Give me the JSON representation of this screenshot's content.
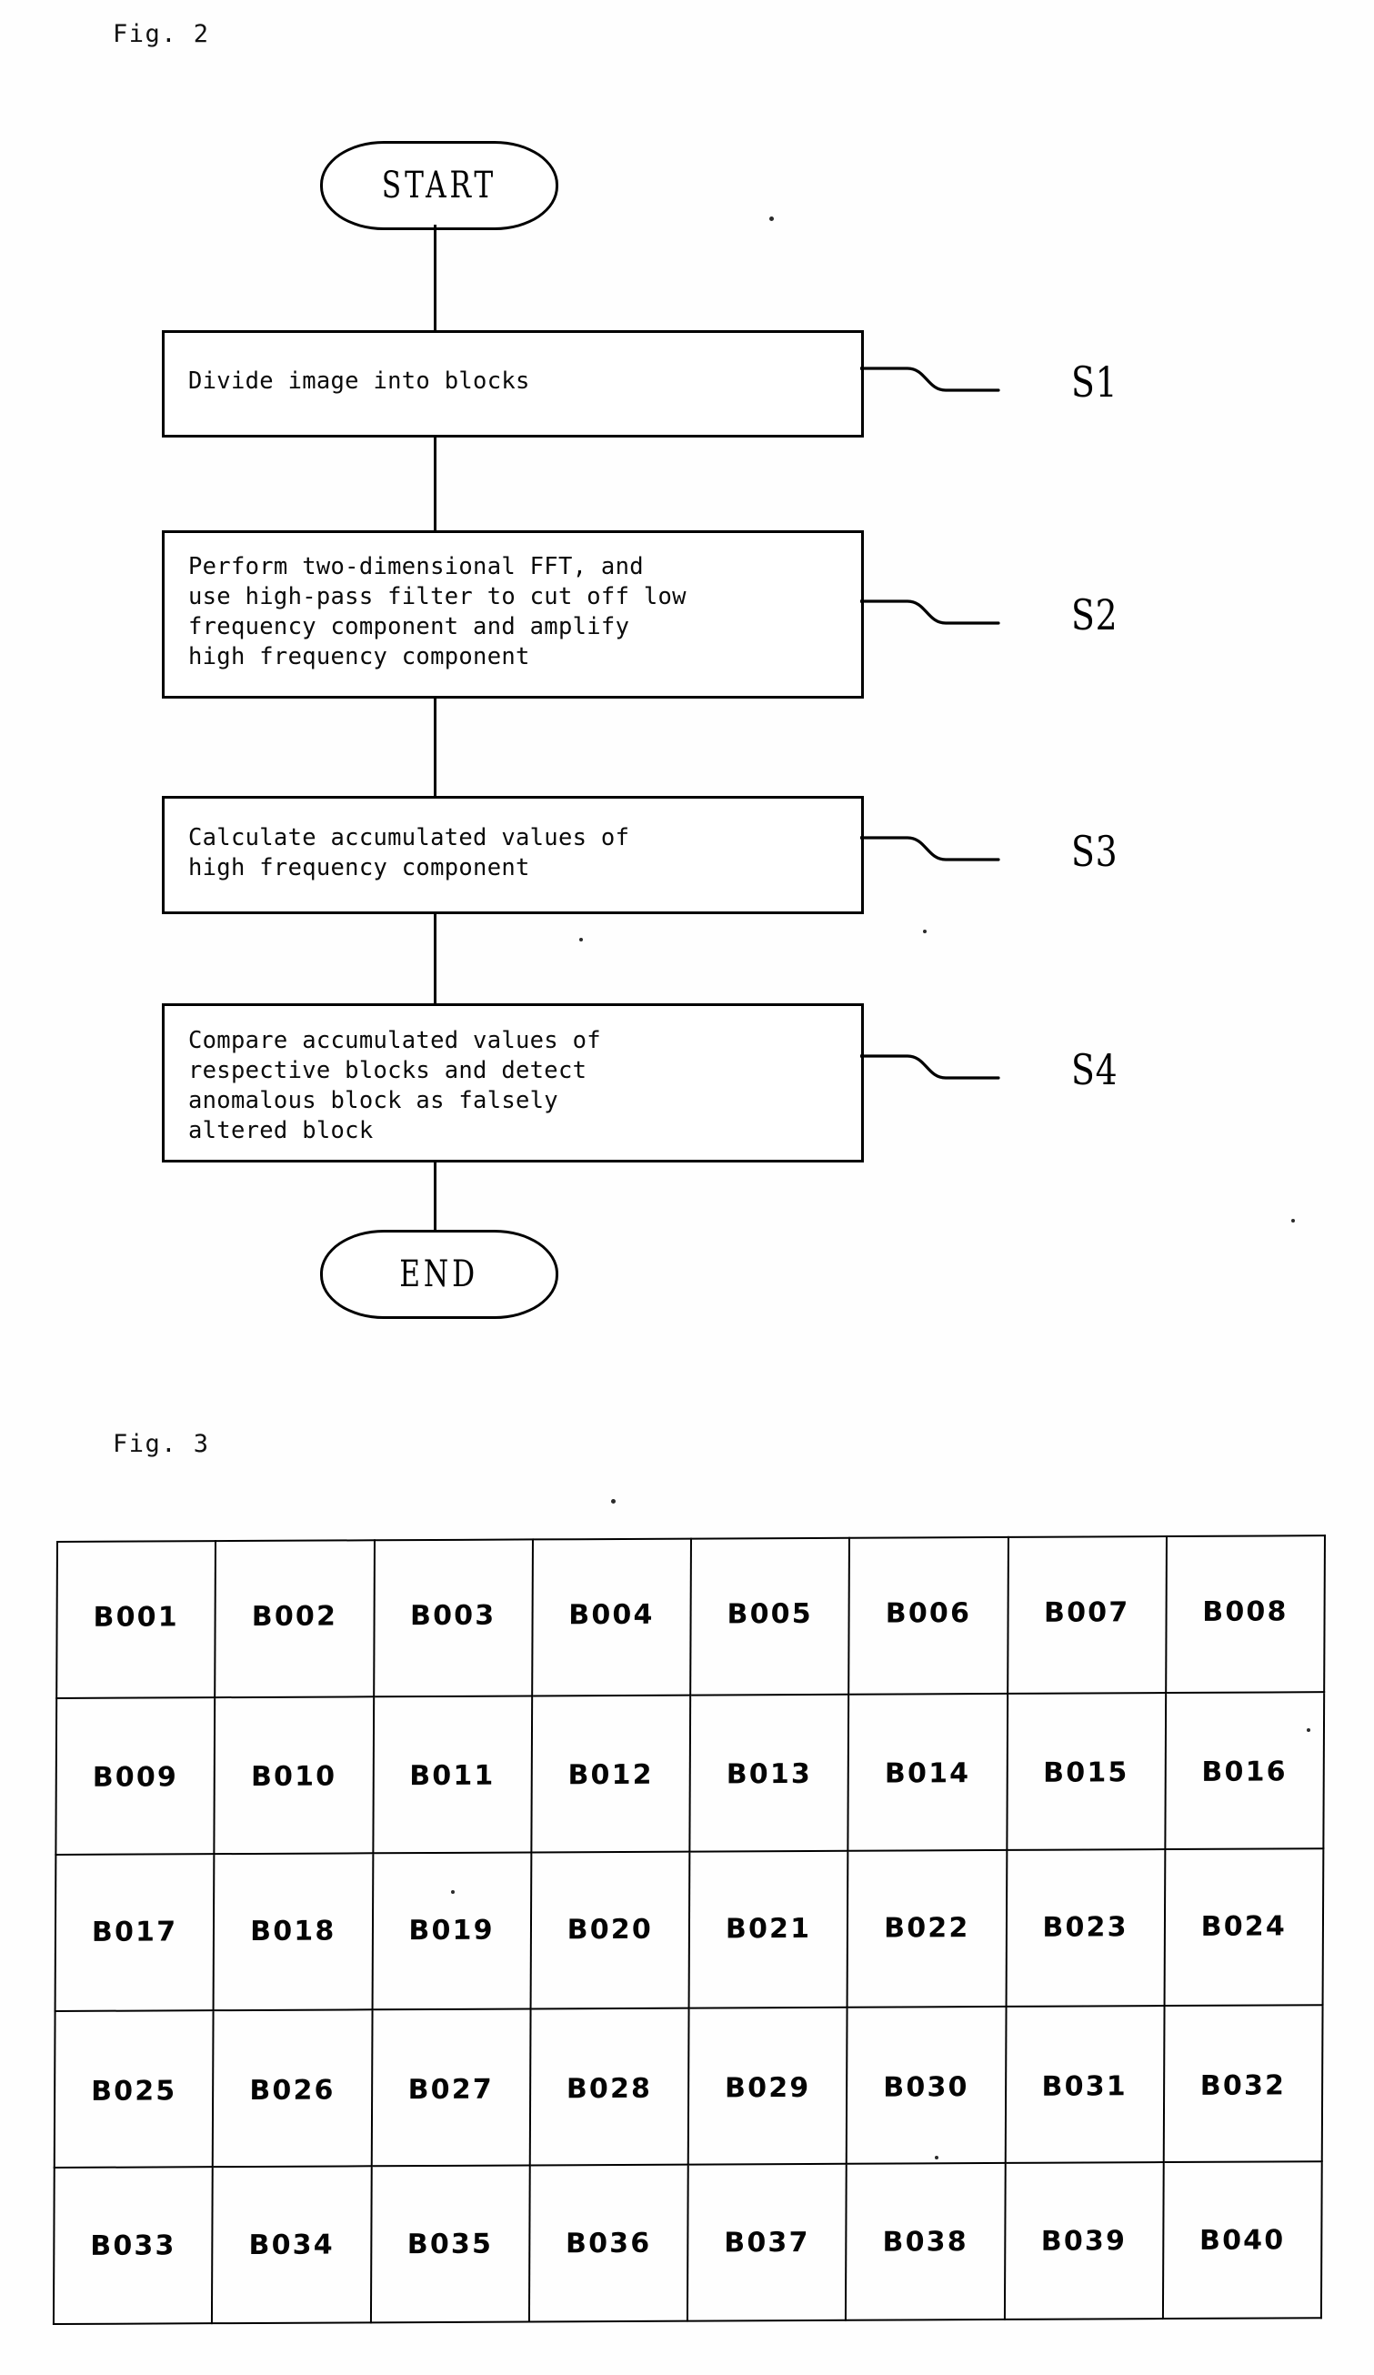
{
  "sheet": {
    "background_color": "#ffffff",
    "ink_color": "#000000"
  },
  "fig2": {
    "caption": "Fig. 2",
    "start_terminator": {
      "label": "START",
      "shape": "rounded-terminator"
    },
    "end_terminator": {
      "label": "END",
      "shape": "rounded-terminator"
    },
    "steps": [
      {
        "id": "S1",
        "step_label": "S1",
        "lines": [
          "Divide image into blocks"
        ]
      },
      {
        "id": "S2",
        "step_label": "S2",
        "lines": [
          "Perform two-dimensional FFT, and",
          "use high-pass filter to cut off low",
          "frequency component and amplify",
          "high frequency component"
        ]
      },
      {
        "id": "S3",
        "step_label": "S3",
        "lines": [
          "Calculate accumulated values of",
          "high frequency component"
        ]
      },
      {
        "id": "S4",
        "step_label": "S4",
        "lines": [
          "Compare accumulated values of",
          "respective blocks and detect",
          "anomalous block as falsely",
          "altered block"
        ]
      }
    ]
  },
  "fig3": {
    "caption": "Fig. 3",
    "grid": {
      "rows": 5,
      "columns": 8,
      "cells": [
        [
          "B001",
          "B002",
          "B003",
          "B004",
          "B005",
          "B006",
          "B007",
          "B008"
        ],
        [
          "B009",
          "B010",
          "B011",
          "B012",
          "B013",
          "B014",
          "B015",
          "B016"
        ],
        [
          "B017",
          "B018",
          "B019",
          "B020",
          "B021",
          "B022",
          "B023",
          "B024"
        ],
        [
          "B025",
          "B026",
          "B027",
          "B028",
          "B029",
          "B030",
          "B031",
          "B032"
        ],
        [
          "B033",
          "B034",
          "B035",
          "B036",
          "B037",
          "B038",
          "B039",
          "B040"
        ]
      ]
    }
  }
}
